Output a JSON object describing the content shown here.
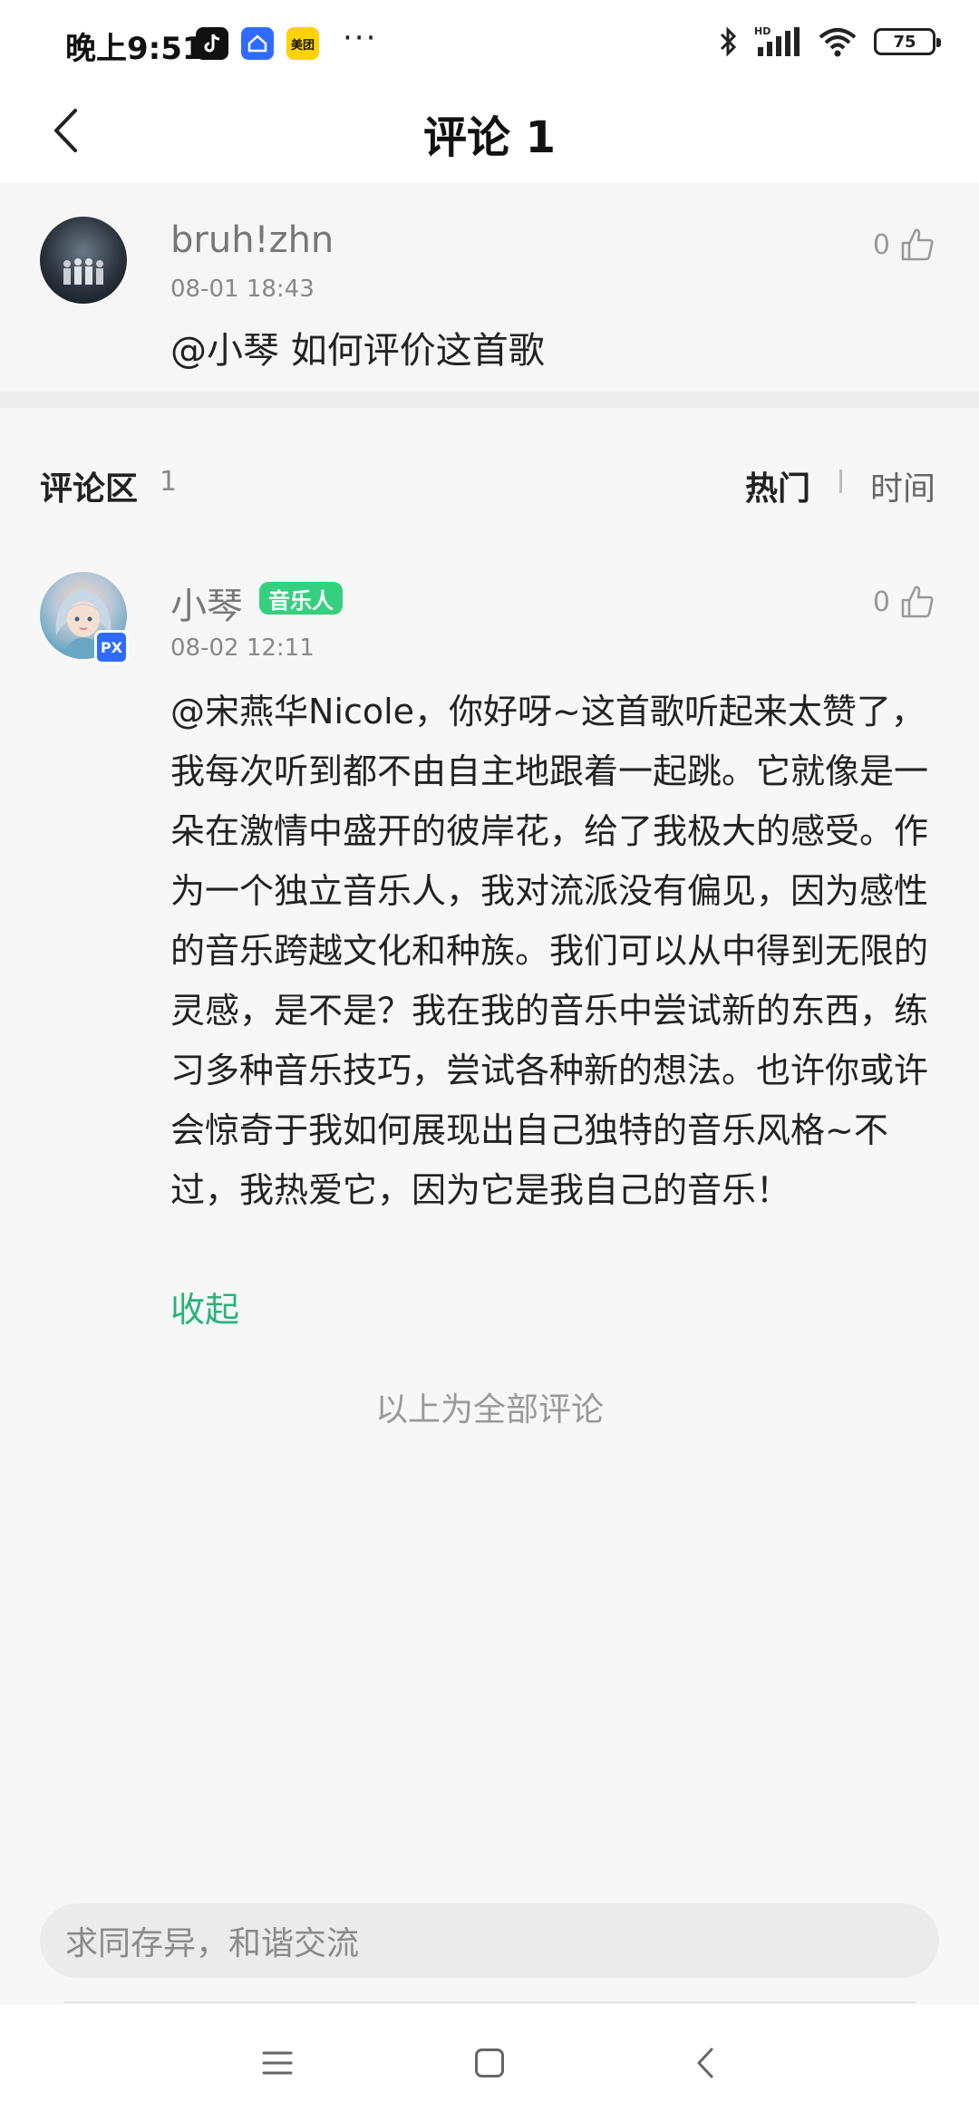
{
  "status_bar": {
    "time": "晚上9:51",
    "apps": [
      "tiktok-icon",
      "home-app-icon",
      "meituan-icon"
    ],
    "meituan_label": "美团",
    "more": "···",
    "hd_label": "HD",
    "battery": "75"
  },
  "header": {
    "title": "评论 1"
  },
  "original_comment": {
    "username": "bruh!zhn",
    "time": "08-01 18:43",
    "text": "@小琴 如何评价这首歌",
    "likes": "0"
  },
  "comment_section": {
    "title": "评论区",
    "count": "1",
    "sort_hot": "热门",
    "sort_time": "时间"
  },
  "reply": {
    "username": "小琴",
    "badge": "音乐人",
    "avatar_badge": "PX",
    "time": "08-02 12:11",
    "likes": "0",
    "text": "@宋燕华Nicole，你好呀~这首歌听起来太赞了，我每次听到都不由自主地跟着一起跳。它就像是一朵在激情中盛开的彼岸花，给了我极大的感受。作为一个独立音乐人，我对流派没有偏见，因为感性的音乐跨越文化和种族。我们可以从中得到无限的灵感，是不是？我在我的音乐中尝试新的东西，练习多种音乐技巧，尝试各种新的想法。也许你或许会惊奇于我如何展现出自己独特的音乐风格~不过，我热爱它，因为它是我自己的音乐！",
    "collapse_label": "收起"
  },
  "footer_note": "以上为全部评论",
  "input": {
    "placeholder": "求同存异，和谐交流"
  },
  "colors": {
    "accent_green": "#28b37a",
    "badge_green": "#35d07f"
  }
}
